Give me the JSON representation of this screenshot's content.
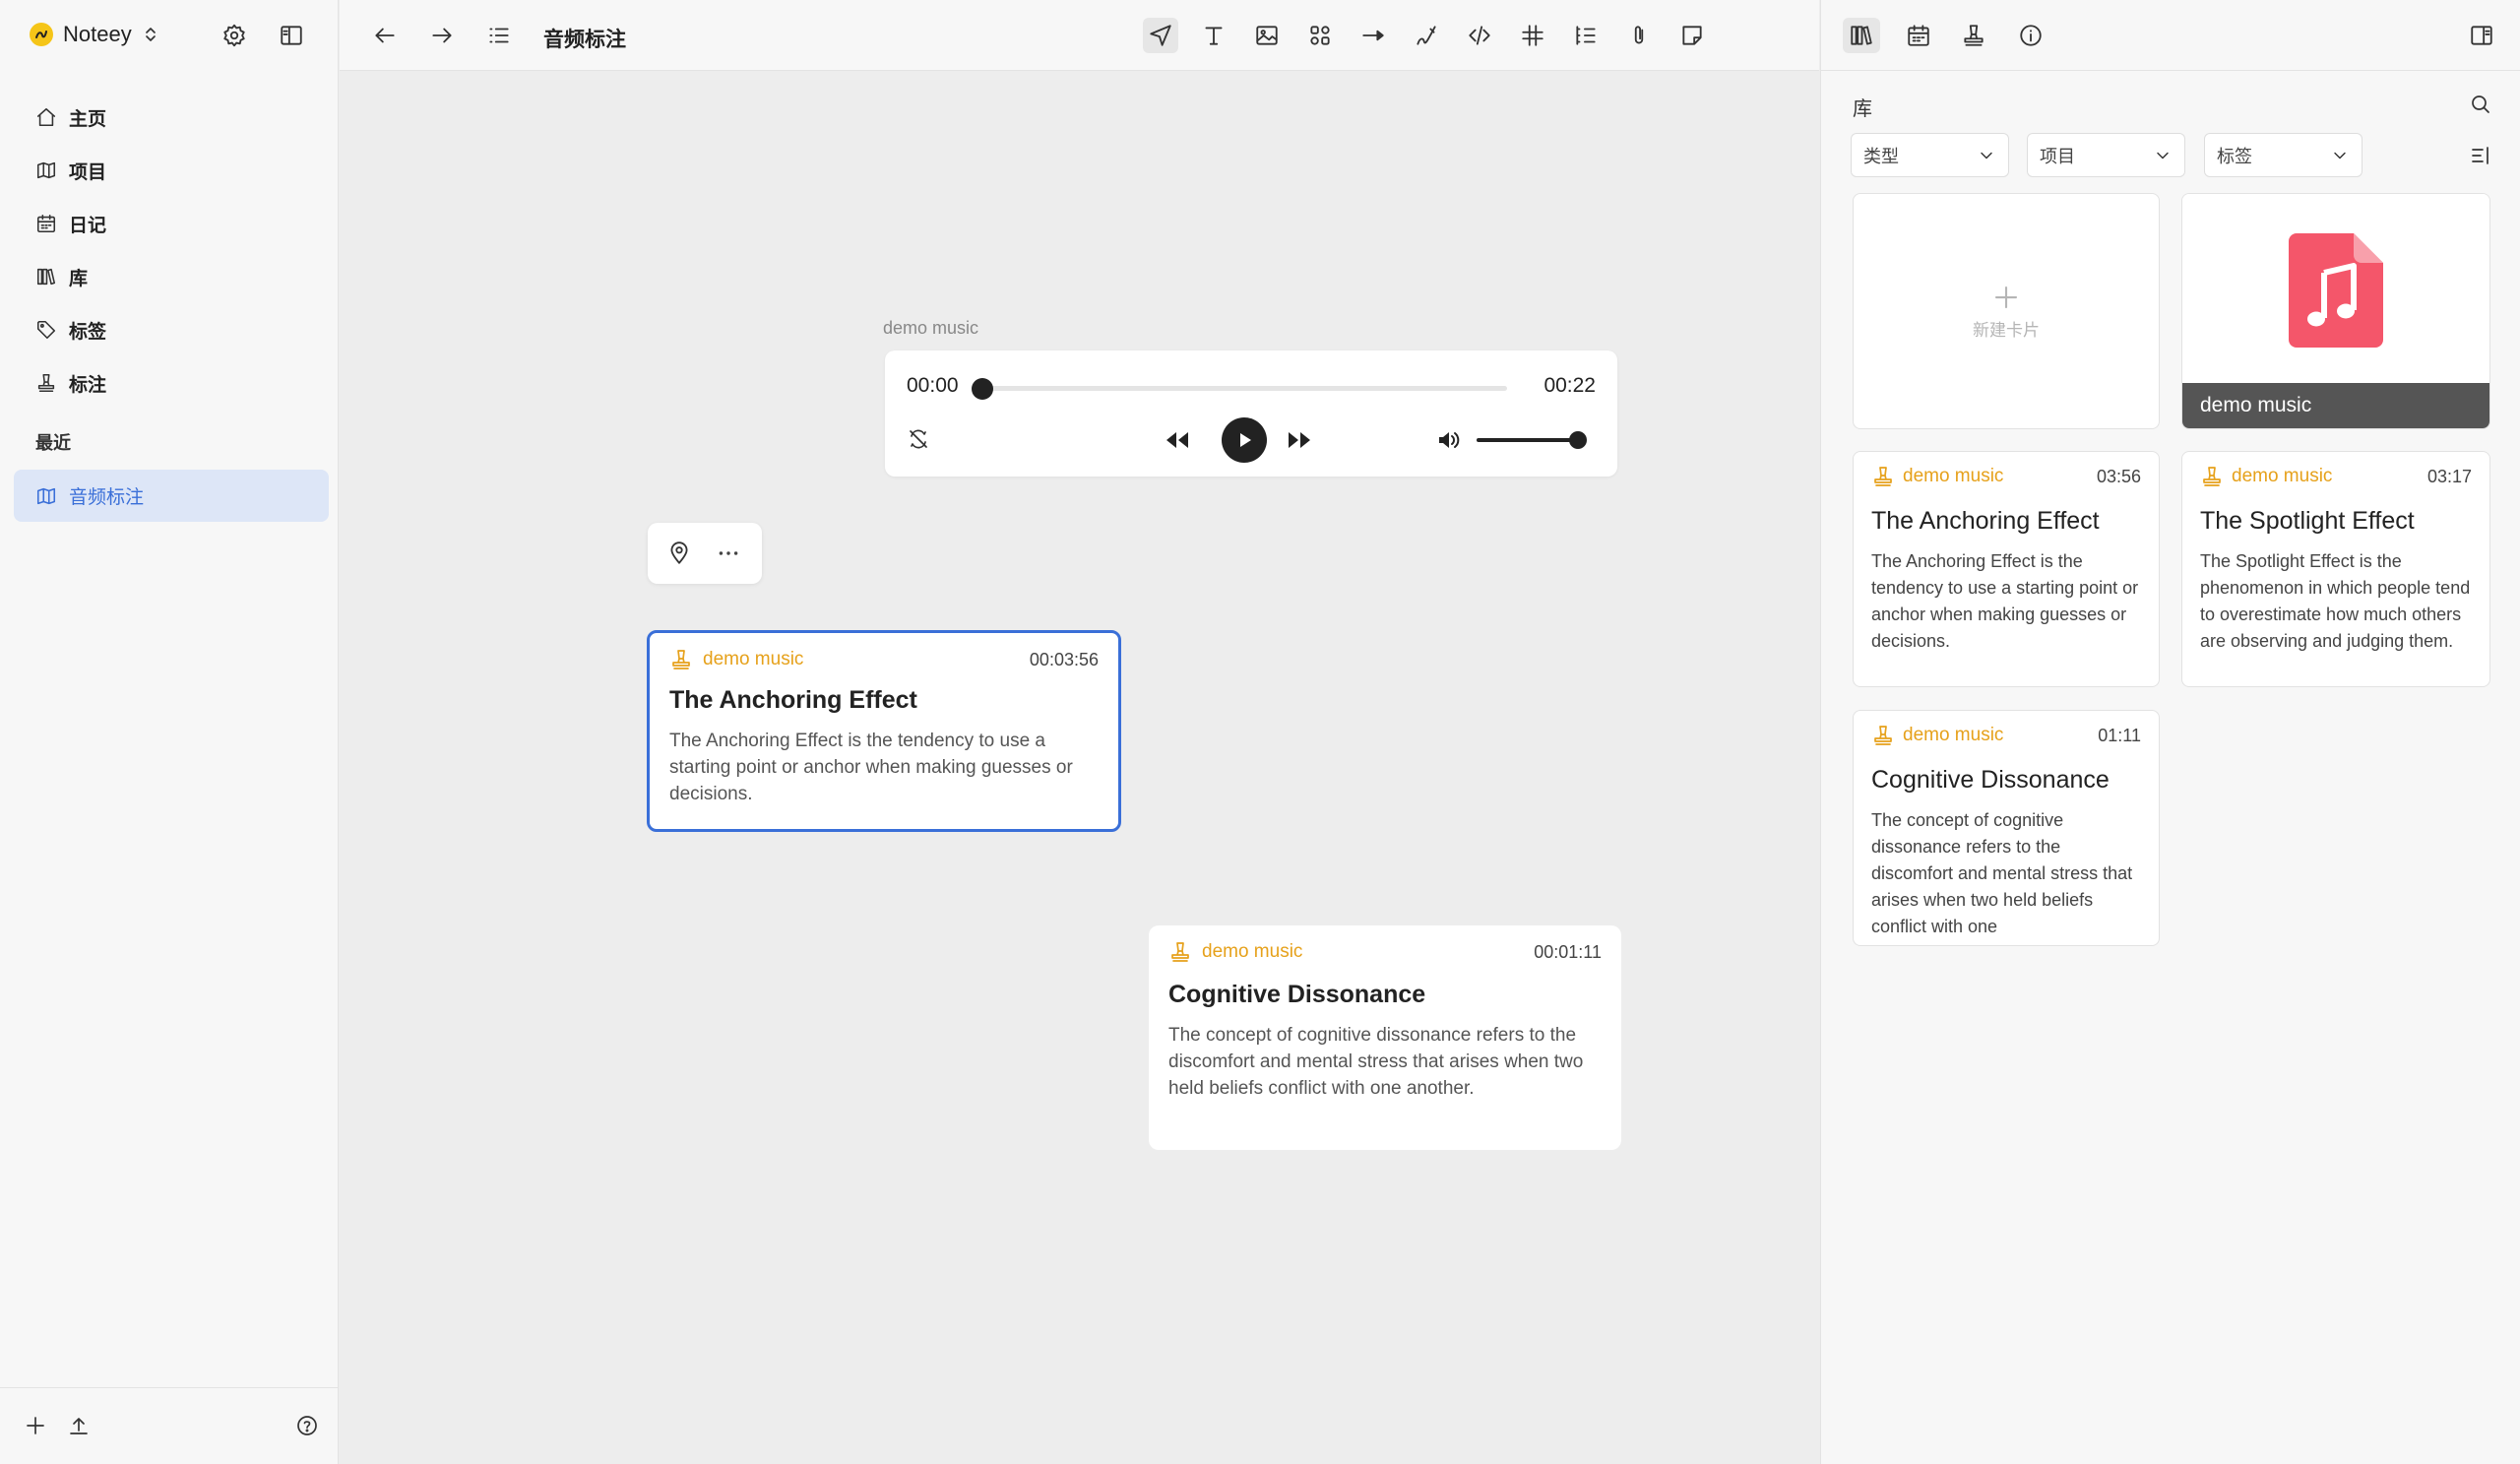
{
  "app": {
    "name": "Noteey"
  },
  "sidebar": {
    "items": [
      {
        "label": "主页",
        "icon": "home-icon"
      },
      {
        "label": "项目",
        "icon": "map-icon"
      },
      {
        "label": "日记",
        "icon": "calendar-icon"
      },
      {
        "label": "库",
        "icon": "library-icon"
      },
      {
        "label": "标签",
        "icon": "tag-icon"
      },
      {
        "label": "标注",
        "icon": "stamp-icon"
      }
    ],
    "recent_label": "最近",
    "recent_items": [
      {
        "label": "音频标注",
        "icon": "map-icon"
      }
    ]
  },
  "toolbar": {
    "page_title": "音频标注"
  },
  "canvas": {
    "audio_label": "demo music",
    "player": {
      "current_time": "00:00",
      "duration": "00:22",
      "progress": 0,
      "volume": 1.0
    },
    "notes": [
      {
        "source": "demo music",
        "timestamp": "00:03:56",
        "title": "The Anchoring Effect",
        "body": "The Anchoring Effect is the tendency to use a starting point or anchor when making guesses or decisions.",
        "selected": true
      },
      {
        "source": "demo music",
        "timestamp": "00:01:11",
        "title": "Cognitive Dissonance",
        "body": "The concept of cognitive dissonance refers to the discomfort and mental stress that arises when two held beliefs conflict with one another.",
        "selected": false
      }
    ]
  },
  "right_panel": {
    "library_label": "库",
    "filters": [
      {
        "label": "类型"
      },
      {
        "label": "项目"
      },
      {
        "label": "标签"
      }
    ],
    "new_card_label": "新建卡片",
    "media_card": {
      "caption": "demo music",
      "icon": "music-file-icon",
      "accent": "#f4566a"
    },
    "cards": [
      {
        "source": "demo music",
        "timestamp": "03:56",
        "title": "The Anchoring Effect",
        "body": "The Anchoring Effect is the tendency to use a starting point or anchor when making guesses or decisions."
      },
      {
        "source": "demo music",
        "timestamp": "03:17",
        "title": "The Spotlight Effect",
        "body": "The Spotlight Effect is the phenomenon in which people tend to overestimate how much others are observing and judging them."
      },
      {
        "source": "demo music",
        "timestamp": "01:11",
        "title": "Cognitive Dissonance",
        "body": "The concept of cognitive dissonance refers to the discomfort and mental stress that arises when two held beliefs conflict with one"
      }
    ]
  },
  "colors": {
    "accent": "#3a6fd8",
    "annotation": "#e6a11b",
    "selected_bg": "#dde6f7"
  }
}
